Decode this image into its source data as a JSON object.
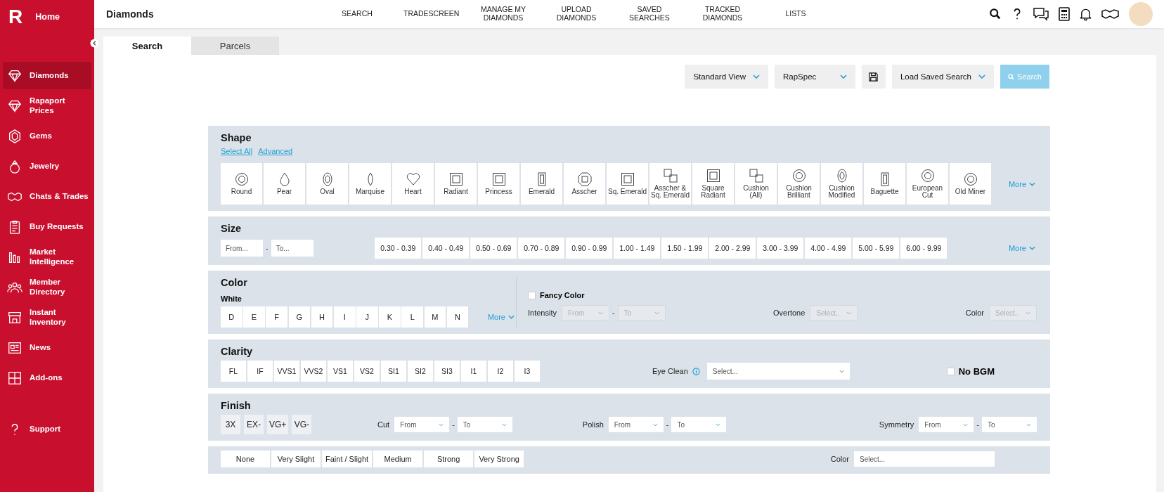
{
  "sidebar": {
    "logo": "R",
    "home": "Home",
    "items": [
      {
        "label": "Diamonds",
        "selected": true
      },
      {
        "label": "Rapaport Prices",
        "selected": false
      },
      {
        "label": "Gems",
        "selected": false
      },
      {
        "label": "Jewelry",
        "selected": false
      },
      {
        "label": "Chats & Trades",
        "selected": false
      },
      {
        "label": "Buy Requests",
        "selected": false
      },
      {
        "label": "Market Intelligence",
        "selected": false
      },
      {
        "label": "Member Directory",
        "selected": false
      },
      {
        "label": "Instant Inventory",
        "selected": false
      },
      {
        "label": "News",
        "selected": false
      },
      {
        "label": "Add-ons",
        "selected": false
      }
    ],
    "support": "Support"
  },
  "header": {
    "title": "Diamonds",
    "nav": [
      "SEARCH",
      "TRADESCREEN",
      "MANAGE MY DIAMONDS",
      "UPLOAD DIAMONDS",
      "SAVED SEARCHES",
      "TRACKED DIAMONDS",
      "LISTS"
    ]
  },
  "tabs": [
    {
      "label": "Search",
      "selected": true
    },
    {
      "label": "Parcels",
      "selected": false
    }
  ],
  "toolbar": {
    "view_select": "Standard View",
    "spec_select": "RapSpec",
    "load_saved": "Load Saved Search",
    "search_button": {
      "label": "Search",
      "disabled": true
    }
  },
  "shape": {
    "title": "Shape",
    "links": [
      "Select All",
      "Advanced"
    ],
    "more": "More",
    "shapes": [
      "Round",
      "Pear",
      "Oval",
      "Marquise",
      "Heart",
      "Radiant",
      "Princess",
      "Emerald",
      "Asscher",
      "Sq. Emerald",
      "Asscher & Sq. Emerald",
      "Square Radiant",
      "Cushion (All)",
      "Cushion Brilliant",
      "Cushion Modified",
      "Baguette",
      "European Cut",
      "Old Miner"
    ]
  },
  "size": {
    "title": "Size",
    "from_placeholder": "From...",
    "separator": "-",
    "to_placeholder": "To...",
    "more": "More",
    "ranges": [
      "0.30 - 0.39",
      "0.40 - 0.49",
      "0.50 - 0.69",
      "0.70 - 0.89",
      "0.90 - 0.99",
      "1.00 - 1.49",
      "1.50 - 1.99",
      "2.00 - 2.99",
      "3.00 - 3.99",
      "4.00 - 4.99",
      "5.00 - 5.99",
      "6.00 - 9.99"
    ]
  },
  "color": {
    "title": "Color",
    "white_label": "White",
    "grades": [
      "D",
      "E",
      "F",
      "G",
      "H",
      "I",
      "J",
      "K",
      "L",
      "M",
      "N"
    ],
    "more": "More",
    "fancy": {
      "label": "Fancy Color",
      "checked": false
    },
    "intensity": {
      "label": "Intensity",
      "from": "From",
      "separator": "-",
      "to": "To",
      "disabled": true
    },
    "overtone": {
      "label": "Overtone",
      "placeholder": "Select..",
      "disabled": true
    },
    "color_select": {
      "label": "Color",
      "placeholder": "Select..",
      "disabled": true
    }
  },
  "clarity": {
    "title": "Clarity",
    "grades": [
      "FL",
      "IF",
      "VVS1",
      "VVS2",
      "VS1",
      "VS2",
      "SI1",
      "SI2",
      "SI3",
      "I1",
      "I2",
      "I3"
    ],
    "eye_clean": {
      "label": "Eye Clean",
      "placeholder": "Select..."
    },
    "no_bgm": {
      "label": "No BGM",
      "checked": false
    }
  },
  "finish": {
    "title": "Finish",
    "grades": [
      "3X",
      "EX-",
      "VG+",
      "VG-"
    ],
    "selects": [
      {
        "label": "Cut",
        "from": "From",
        "separator": "-",
        "to": "To"
      },
      {
        "label": "Polish",
        "from": "From",
        "separator": "-",
        "to": "To"
      },
      {
        "label": "Symmetry",
        "from": "From",
        "separator": "-",
        "to": "To"
      }
    ]
  },
  "fluorescence": {
    "options": [
      "None",
      "Very Slight",
      "Faint / Slight",
      "Medium",
      "Strong",
      "Very Strong"
    ],
    "color_label": "Color",
    "color_placeholder": "Select..."
  }
}
